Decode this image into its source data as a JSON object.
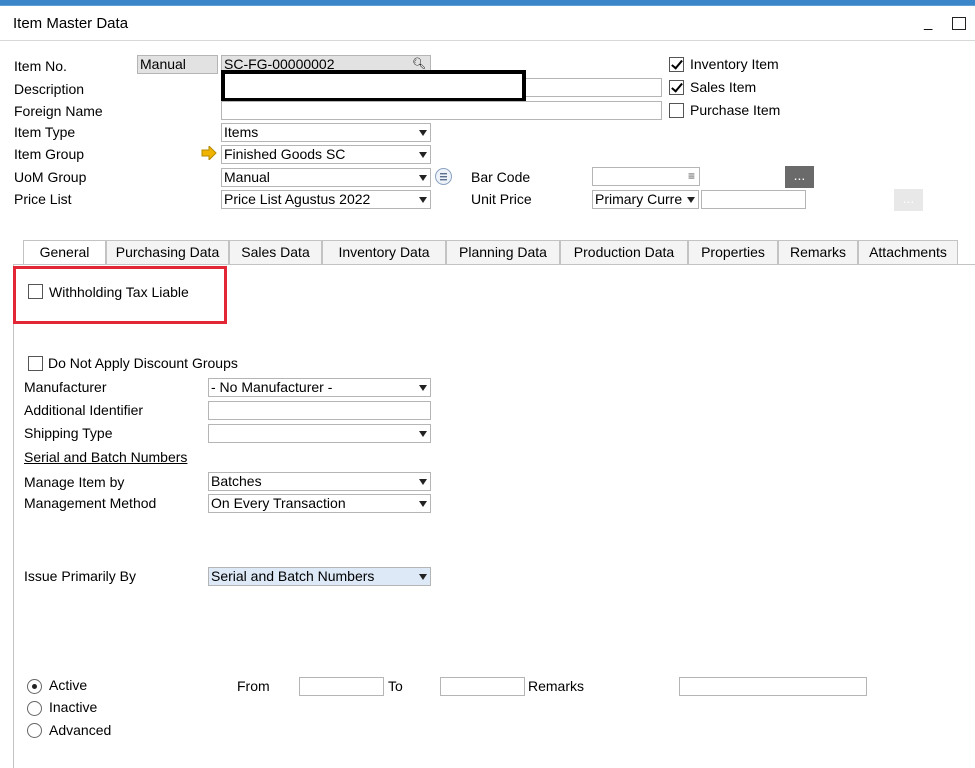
{
  "window": {
    "title": "Item Master Data"
  },
  "header": {
    "item_no_label": "Item No.",
    "numbering_series": "Manual",
    "item_no_value": "SC-FG-00000002",
    "description_label": "Description",
    "description_value": "",
    "foreign_name_label": "Foreign Name",
    "foreign_name_value": "",
    "item_type_label": "Item Type",
    "item_type_value": "Items",
    "item_group_label": "Item Group",
    "item_group_value": "Finished Goods SC",
    "uom_group_label": "UoM Group",
    "uom_group_value": "Manual",
    "price_list_label": "Price List",
    "price_list_value": "Price List Agustus 2022",
    "bar_code_label": "Bar Code",
    "bar_code_value": "",
    "unit_price_label": "Unit Price",
    "currency_value": "Primary Curre",
    "unit_price_value": "",
    "dots": "...",
    "inventory_item": {
      "label": "Inventory Item",
      "checked": true
    },
    "sales_item": {
      "label": "Sales Item",
      "checked": true
    },
    "purchase_item": {
      "label": "Purchase Item",
      "checked": false
    }
  },
  "tabs": [
    {
      "label": "General",
      "active": true
    },
    {
      "label": "Purchasing Data"
    },
    {
      "label": "Sales Data"
    },
    {
      "label": "Inventory Data"
    },
    {
      "label": "Planning Data"
    },
    {
      "label": "Production Data"
    },
    {
      "label": "Properties"
    },
    {
      "label": "Remarks"
    },
    {
      "label": "Attachments"
    }
  ],
  "general": {
    "withholding_tax_liable": {
      "label": "Withholding Tax Liable",
      "checked": false
    },
    "do_not_apply_discount_groups": {
      "label": "Do Not Apply Discount Groups",
      "checked": false
    },
    "manufacturer_label": "Manufacturer",
    "manufacturer_value": "- No Manufacturer -",
    "additional_identifier_label": "Additional Identifier",
    "additional_identifier_value": "",
    "shipping_type_label": "Shipping Type",
    "shipping_type_value": "",
    "serial_batch_heading": "Serial and Batch Numbers",
    "manage_item_by_label": "Manage Item by",
    "manage_item_by_value": "Batches",
    "management_method_label": "Management Method",
    "management_method_value": "On Every Transaction",
    "issue_primarily_by_label": "Issue Primarily By",
    "issue_primarily_by_value": "Serial and Batch Numbers",
    "status_options": [
      "Active",
      "Inactive",
      "Advanced"
    ],
    "status_selected": "Active",
    "from_label": "From",
    "from_value": "",
    "to_label": "To",
    "to_value": "",
    "remarks_label": "Remarks",
    "remarks_value": ""
  },
  "colors": {
    "highlight_box": "#e32636",
    "redaction_box": "#000000",
    "arrow_icon": "#f0b400",
    "title_accent": "#3a86c8"
  }
}
